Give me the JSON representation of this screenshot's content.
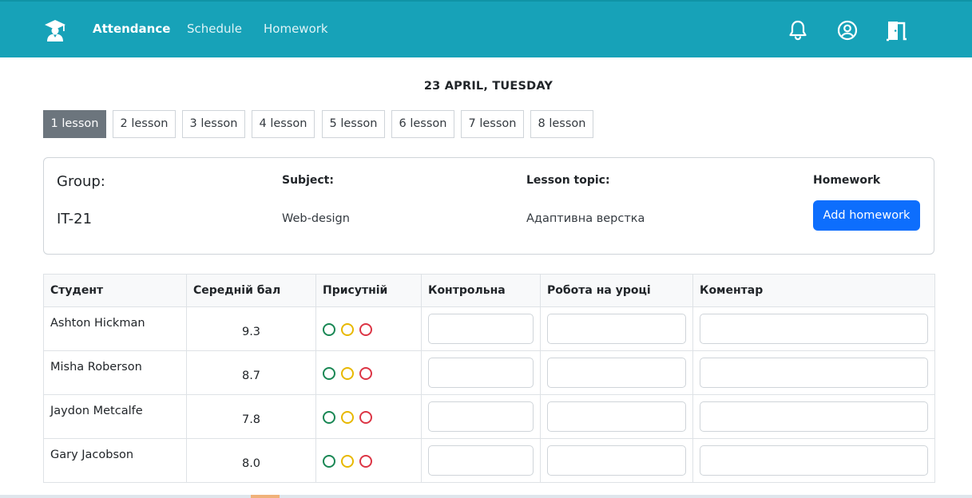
{
  "nav": {
    "logo_icon": "graduation-cap-icon",
    "links": [
      {
        "label": "Attendance",
        "active": true
      },
      {
        "label": "Schedule",
        "active": false
      },
      {
        "label": "Homework",
        "active": false
      }
    ],
    "icons": [
      "bell-icon",
      "user-circle-icon",
      "logout-door-icon"
    ],
    "bg_color": "#17a2b8"
  },
  "date_title": "23 APRIL, TUESDAY",
  "lessons": [
    "1 lesson",
    "2 lesson",
    "3 lesson",
    "4 lesson",
    "5 lesson",
    "6 lesson",
    "7 lesson",
    "8 lesson"
  ],
  "active_lesson": "1 lesson",
  "info": {
    "group_label": "Group:",
    "group_value": "IT-21",
    "subject_label": "Subject:",
    "subject_value": "Web-design",
    "topic_label": "Lesson topic:",
    "topic_value": "Адаптивна верстка",
    "homework_label": "Homework",
    "add_homework_label": "Add homework"
  },
  "table": {
    "headers": [
      "Студент",
      "Середній бал",
      "Присутній",
      "Контрольна",
      "Робота на уроці",
      "Коментар"
    ],
    "rows": [
      {
        "name": "Ashton Hickman",
        "avg": "9.3"
      },
      {
        "name": "Misha Roberson",
        "avg": "8.7"
      },
      {
        "name": "Jaydon Metcalfe",
        "avg": "7.8"
      },
      {
        "name": "Gary Jacobson",
        "avg": "8.0"
      }
    ]
  },
  "colors": {
    "present": "#198754",
    "late": "#e8b800",
    "absent": "#dc3545",
    "primary": "#0d6efd",
    "active_tab": "#6c757d"
  }
}
